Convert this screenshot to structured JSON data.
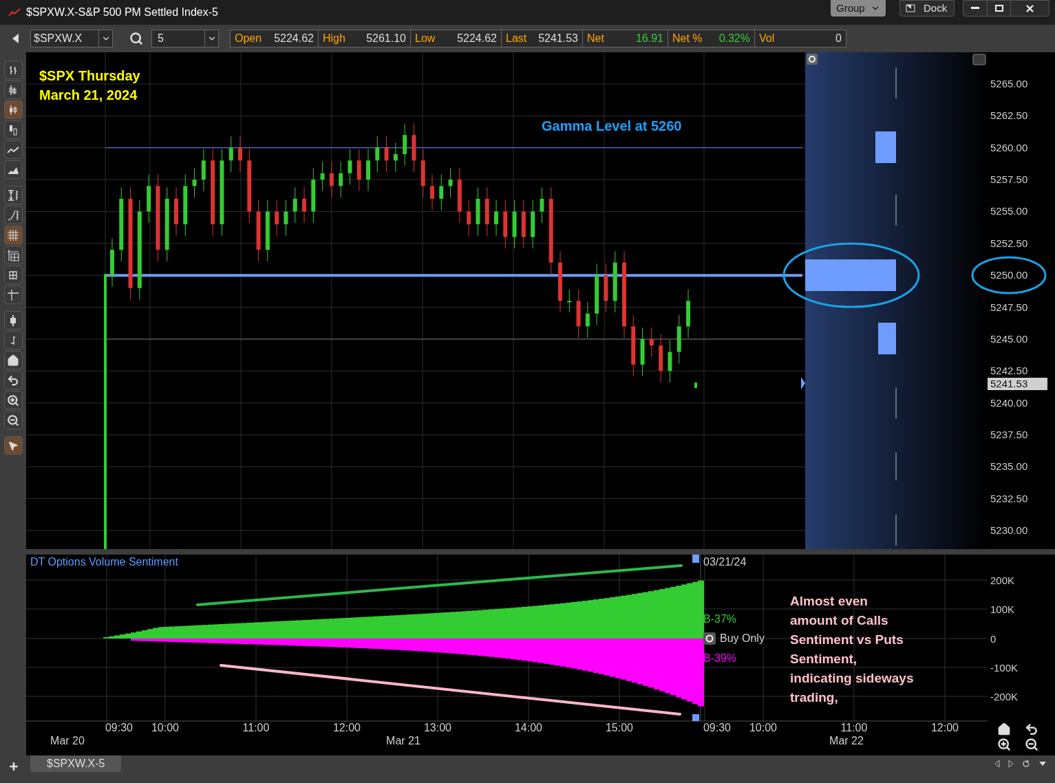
{
  "window": {
    "title": "$SPXW.X-S&P 500 PM Settled Index-5",
    "buttons": [
      "Group",
      "Dock"
    ]
  },
  "toolbar": {
    "symbol": "$SPXW.X",
    "interval": "5",
    "quotes": [
      {
        "label": "Open",
        "value": "5224.62",
        "kind": "plain"
      },
      {
        "label": "High",
        "value": "5261.10",
        "kind": "plain"
      },
      {
        "label": "Low",
        "value": "5224.62",
        "kind": "plain"
      },
      {
        "label": "Last",
        "value": "5241.53",
        "kind": "plain"
      },
      {
        "label": "Net",
        "value": "16.91",
        "kind": "up"
      },
      {
        "label": "Net %",
        "value": "0.32%",
        "kind": "up"
      },
      {
        "label": "Vol",
        "value": "0",
        "kind": "plain"
      }
    ]
  },
  "tools": [
    {
      "kind": "bars",
      "selected": false
    },
    {
      "kind": "hlc",
      "selected": false
    },
    {
      "kind": "candles",
      "selected": true
    },
    {
      "kind": "ohlc",
      "selected": false
    },
    {
      "kind": "line",
      "selected": false
    },
    {
      "kind": "area",
      "selected": false
    },
    {
      "kind": "fit",
      "selected": false
    },
    {
      "kind": "log",
      "selected": false
    },
    {
      "kind": "grid",
      "selected": true
    },
    {
      "kind": "axis-grid",
      "selected": false
    },
    {
      "kind": "small-grid",
      "selected": false
    },
    {
      "kind": "crosshair",
      "selected": false
    },
    {
      "kind": "box",
      "selected": false
    },
    {
      "kind": "tick",
      "selected": false
    },
    {
      "kind": "home",
      "selected": false
    },
    {
      "kind": "undo",
      "selected": false
    },
    {
      "kind": "zoom-in",
      "selected": false
    },
    {
      "kind": "zoom-out",
      "selected": false
    },
    {
      "kind": "pointer",
      "selected": true
    }
  ],
  "price_chart": {
    "title_lines": [
      "$SPX Thursday",
      "March 21, 2024"
    ],
    "annotation": "Gamma Level at 5260",
    "price_axis": [
      "5265.00",
      "5262.50",
      "5260.00",
      "5257.50",
      "5255.00",
      "5252.50",
      "5250.00",
      "5247.50",
      "5245.00",
      "5242.50",
      "5240.00",
      "5237.50",
      "5235.00",
      "5232.50",
      "5230.00"
    ],
    "last_price": "5241.53"
  },
  "sentiment": {
    "title": "DT Options Volume Sentiment",
    "date": "03/21/24",
    "calls_label": "B-37%",
    "mode": "Buy Only",
    "puts_label": "B-39%",
    "axis": [
      "200K",
      "100K",
      "0",
      "-100K",
      "-200K"
    ],
    "note_lines": [
      "Almost even",
      "amount of Calls",
      "Sentiment vs Puts",
      "Sentiment,",
      "indicating sideways",
      "trading,"
    ]
  },
  "time_axis": {
    "ticks": [
      "09:30",
      "10:00",
      "11:00",
      "12:00",
      "13:00",
      "14:00",
      "15:00",
      "09:30",
      "10:00",
      "11:00",
      "12:00"
    ],
    "dates": [
      "Mar 20",
      "Mar 21",
      "Mar 22"
    ]
  },
  "tabs": [
    {
      "label": "$SPXW.X-5",
      "selected": true
    }
  ]
}
